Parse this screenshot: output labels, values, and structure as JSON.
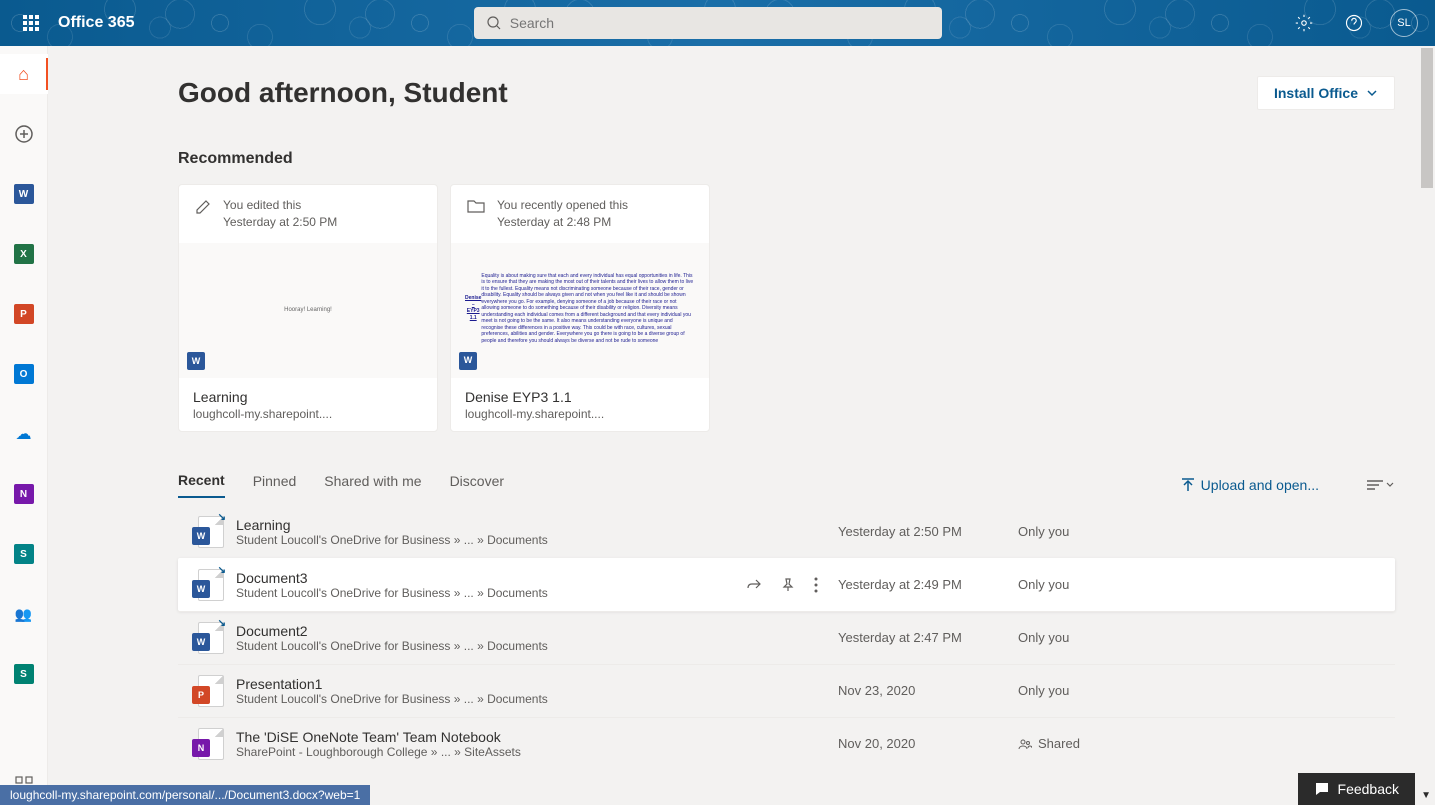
{
  "header": {
    "brand": "Office 365",
    "search_placeholder": "Search",
    "avatar_initials": "SL"
  },
  "sidebar": {
    "items": [
      {
        "name": "home",
        "color": "#f25022",
        "label": "🏠",
        "active": true
      },
      {
        "name": "create",
        "color": "transparent",
        "label": "+"
      },
      {
        "name": "word",
        "color": "#2b579a",
        "label": "W"
      },
      {
        "name": "excel",
        "color": "#217346",
        "label": "X"
      },
      {
        "name": "powerpoint",
        "color": "#d24726",
        "label": "P"
      },
      {
        "name": "outlook",
        "color": "#0078d4",
        "label": "O"
      },
      {
        "name": "onedrive",
        "color": "#0078d4",
        "label": "☁"
      },
      {
        "name": "onenote",
        "color": "#7719aa",
        "label": "N"
      },
      {
        "name": "sharepoint",
        "color": "#038387",
        "label": "S"
      },
      {
        "name": "teams",
        "color": "#5059c9",
        "label": "👥"
      },
      {
        "name": "sway",
        "color": "#008272",
        "label": "S"
      }
    ],
    "footer": {
      "name": "all-apps",
      "label": "⊞"
    }
  },
  "main": {
    "greeting": "Good afternoon, Student",
    "install_label": "Install Office",
    "recommended": {
      "title": "Recommended",
      "cards": [
        {
          "action": "You edited this",
          "time": "Yesterday at 2:50 PM",
          "icon": "pencil",
          "preview_text": "Hooray! Learning!",
          "title": "Learning",
          "location": "loughcoll-my.sharepoint....",
          "badge_color": "#2b579a",
          "badge_letter": "W"
        },
        {
          "action": "You recently opened this",
          "time": "Yesterday at 2:48 PM",
          "icon": "folder",
          "preview_title": "Denise – EYP3 1.1",
          "preview_body": "Equality is about making sure that each and every individual has equal opportunities in life. This is to ensure that they are making the most out of their talents and their lives to allow them to live it to the fullest. Equality means not discriminating someone because of their race, gender or disability. Equality should be always given and not when you feel like it and should be shown everywhere you go. For example, denying someone of a job because of their race or not allowing someone to do something because of their disability or religion. Diversity means understanding each individual comes from a different background and that every individual you meet is not going to be the same. It also means understanding everyone is unique and recognise these differences in a positive way. This could be with race, cultures, sexual preferences, abilities and gender. Everywhere you go there is going to be a diverse group of people and therefore you should always be diverse and not be rude to someone",
          "title": "Denise EYP3 1.1",
          "location": "loughcoll-my.sharepoint....",
          "badge_color": "#2b579a",
          "badge_letter": "W"
        }
      ]
    },
    "tabs": {
      "items": [
        "Recent",
        "Pinned",
        "Shared with me",
        "Discover"
      ],
      "active": 0,
      "upload_label": "Upload and open..."
    },
    "files": [
      {
        "name": "Learning",
        "path": "Student Loucoll's OneDrive for Business » ... » Documents",
        "time": "Yesterday at 2:50 PM",
        "share": "Only you",
        "badge_color": "#2b579a",
        "badge_letter": "W",
        "arrow": true
      },
      {
        "name": "Document3",
        "path": "Student Loucoll's OneDrive for Business » ... » Documents",
        "time": "Yesterday at 2:49 PM",
        "share": "Only you",
        "badge_color": "#2b579a",
        "badge_letter": "W",
        "arrow": true,
        "hover": true
      },
      {
        "name": "Document2",
        "path": "Student Loucoll's OneDrive for Business » ... » Documents",
        "time": "Yesterday at 2:47 PM",
        "share": "Only you",
        "badge_color": "#2b579a",
        "badge_letter": "W",
        "arrow": true
      },
      {
        "name": "Presentation1",
        "path": "Student Loucoll's OneDrive for Business » ... » Documents",
        "time": "Nov 23, 2020",
        "share": "Only you",
        "badge_color": "#d24726",
        "badge_letter": "P"
      },
      {
        "name": "The 'DiSE OneNote Team' Team Notebook",
        "path": "SharePoint - Loughborough College » ... » SiteAssets",
        "time": "Nov 20, 2020",
        "share": "Shared",
        "share_icon": true,
        "badge_color": "#7719aa",
        "badge_letter": "N"
      }
    ]
  },
  "status_url": "loughcoll-my.sharepoint.com/personal/.../Document3.docx?web=1",
  "feedback_label": "Feedback"
}
